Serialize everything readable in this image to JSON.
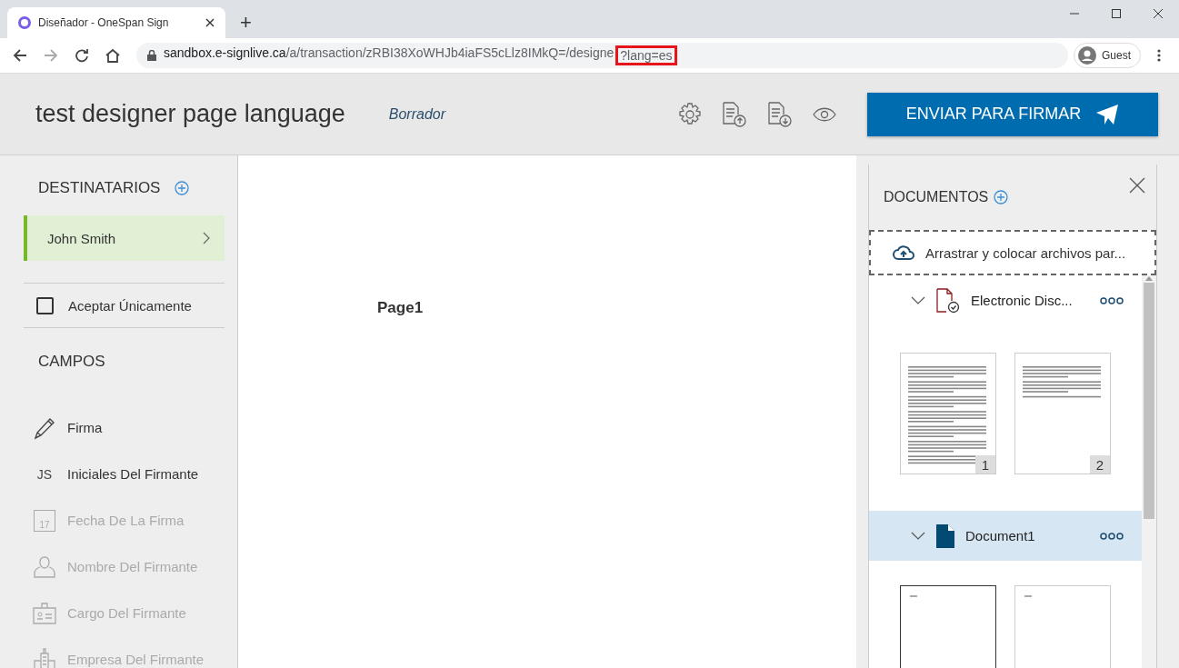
{
  "browser": {
    "tab_title": "Diseñador - OneSpan Sign",
    "new_tab": "+",
    "url_host": "sandbox.e-signlive.ca",
    "url_path": "/a/transaction/zRBI38XoWHJb4iaFS5cLlz8IMkQ=/designe",
    "url_highlight": "?lang=es",
    "profile": "Guest"
  },
  "header": {
    "title": "test designer page language",
    "status": "Borrador",
    "send_button": "ENVIAR PARA FIRMAR"
  },
  "sidebar": {
    "recipients_heading": "DESTINATARIOS",
    "recipients": [
      {
        "name": "John Smith",
        "selected": true
      }
    ],
    "accept_only": {
      "label": "Aceptar Únicamente",
      "checked": false
    },
    "fields_heading": "CAMPOS",
    "fields": [
      {
        "kind": "signature",
        "label": "Firma",
        "disabled": false
      },
      {
        "kind": "initials",
        "label": "Iniciales Del Firmante",
        "icon_text": "JS",
        "disabled": false
      },
      {
        "kind": "date",
        "label": "Fecha De La Firma",
        "icon_text": "17",
        "disabled": true
      },
      {
        "kind": "name",
        "label": "Nombre Del Firmante",
        "disabled": true
      },
      {
        "kind": "title",
        "label": "Cargo Del Firmante",
        "disabled": true
      },
      {
        "kind": "company",
        "label": "Empresa Del Firmante",
        "disabled": true
      }
    ]
  },
  "canvas": {
    "page_label": "Page1"
  },
  "documents_panel": {
    "heading": "DOCUMENTOS",
    "dropzone": "Arrastrar y colocar archivos par...",
    "documents": [
      {
        "kind": "consent",
        "name": "Electronic Disc...",
        "selected": false,
        "pages": [
          {
            "number": "1",
            "selected": false,
            "kind": "full"
          },
          {
            "number": "2",
            "selected": false,
            "kind": "short"
          }
        ]
      },
      {
        "kind": "file",
        "name": "Document1",
        "selected": true,
        "pages": [
          {
            "selected": true,
            "kind": "blank"
          },
          {
            "selected": false,
            "kind": "blank"
          }
        ]
      }
    ]
  }
}
